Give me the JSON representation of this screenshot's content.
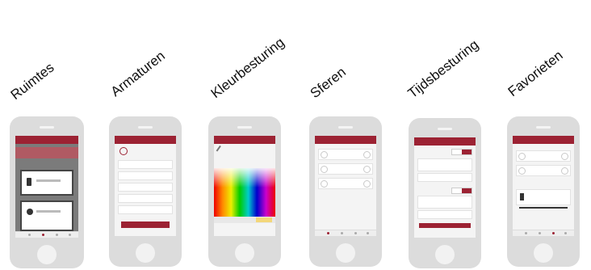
{
  "labels": [
    "Ruimtes",
    "Armaturen",
    "Kleurbesturing",
    "Sferen",
    "Tijdsbesturing",
    "Favorieten"
  ]
}
